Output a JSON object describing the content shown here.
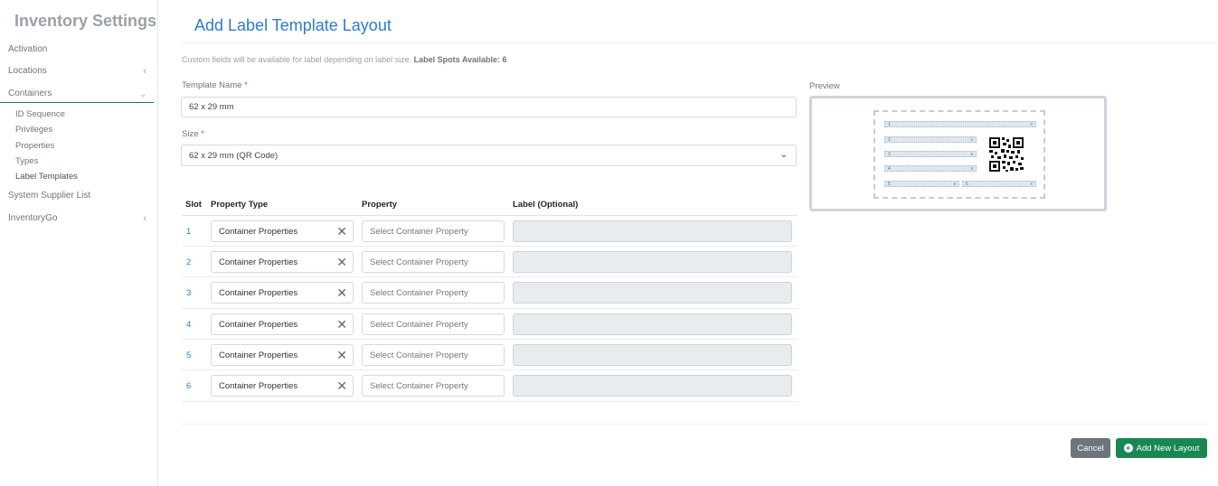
{
  "sidebar": {
    "title": "Inventory Settings",
    "items": [
      {
        "label": "Activation"
      },
      {
        "label": "Locations"
      },
      {
        "label": "Containers"
      },
      {
        "label": "System Supplier List"
      },
      {
        "label": "InventoryGo"
      }
    ],
    "sub_items": [
      {
        "label": "ID Sequence"
      },
      {
        "label": "Privileges"
      },
      {
        "label": "Properties"
      },
      {
        "label": "Types"
      },
      {
        "label": "Label Templates"
      }
    ]
  },
  "page": {
    "title": "Add Label Template Layout",
    "info_text": "Custom fields will be available for label depending on label size.",
    "info_bold": "Label Spots Available: 6"
  },
  "form": {
    "template_name_label": "Template Name",
    "template_name_value": "62 x 29 mm",
    "size_label": "Size",
    "size_value": "62 x 29 mm (QR Code)",
    "required_mark": "*"
  },
  "table": {
    "headers": [
      "Slot",
      "Property Type",
      "Property",
      "Label (Optional)"
    ],
    "rows": [
      {
        "slot": "1",
        "property_type": "Container Properties",
        "property_placeholder": "Select Container Property",
        "label": ""
      },
      {
        "slot": "2",
        "property_type": "Container Properties",
        "property_placeholder": "Select Container Property",
        "label": ""
      },
      {
        "slot": "3",
        "property_type": "Container Properties",
        "property_placeholder": "Select Container Property",
        "label": ""
      },
      {
        "slot": "4",
        "property_type": "Container Properties",
        "property_placeholder": "Select Container Property",
        "label": ""
      },
      {
        "slot": "5",
        "property_type": "Container Properties",
        "property_placeholder": "Select Container Property",
        "label": ""
      },
      {
        "slot": "6",
        "property_type": "Container Properties",
        "property_placeholder": "Select Container Property",
        "label": ""
      }
    ]
  },
  "preview": {
    "label": "Preview",
    "slots": [
      "1",
      "2",
      "3",
      "4",
      "5",
      "6"
    ],
    "remove_mark": "x"
  },
  "actions": {
    "cancel_label": "Cancel",
    "add_label": "Add New Layout"
  },
  "colors": {
    "accent": "#2b7bd0",
    "primary_button": "#198754",
    "secondary_button": "#6c757d",
    "active_rule": "#1f6f6a"
  }
}
